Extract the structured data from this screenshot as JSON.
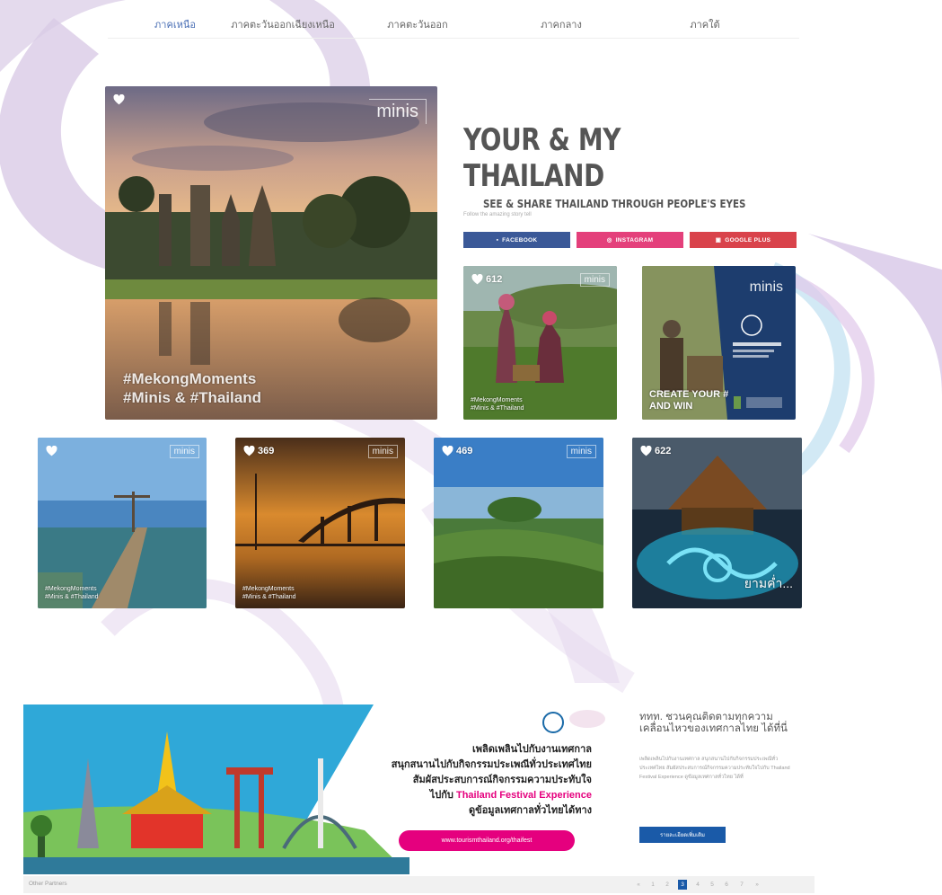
{
  "nav": {
    "items": [
      "ภาคเหนือ",
      "ภาคตะวันออกเฉียงเหนือ",
      "ภาคตะวันออก",
      "ภาคกลาง",
      "ภาคใต้"
    ],
    "active_color": "#4a6fb5"
  },
  "hero": {
    "title_line1": "YOUR & MY",
    "title_line2": "THAILAND",
    "subtitle": "SEE & SHARE THAILAND THROUGH PEOPLE'S EYES",
    "note": "Follow the amazing story tell",
    "main_photo": {
      "brand": "minis",
      "caption_line1": "#MekongMoments",
      "caption_line2": "#Minis & #Thailand"
    }
  },
  "social_buttons": [
    {
      "label": "FACEBOOK",
      "color": "#3b5998",
      "icon": "facebook-icon"
    },
    {
      "label": "INSTAGRAM",
      "color": "#e4407b",
      "icon": "instagram-icon"
    },
    {
      "label": "GOOGLE PLUS",
      "color": "#d9434b",
      "icon": "google-plus-icon"
    }
  ],
  "small_photos": [
    {
      "likes": "612",
      "brand": "minis",
      "caption_line1": "#MekongMoments",
      "caption_line2": "#Minis & #Thailand"
    },
    {
      "brand": "minis",
      "caption_line1": "CREATE YOUR #",
      "caption_line2": "AND WIN"
    }
  ],
  "bottom_photos": [
    {
      "likes": "",
      "brand": "minis",
      "caption_line1": "#MekongMoments",
      "caption_line2": "#Minis & #Thailand"
    },
    {
      "likes": "369",
      "brand": "minis",
      "caption_line1": "#MekongMoments",
      "caption_line2": "#Minis & #Thailand"
    },
    {
      "likes": "469",
      "brand": "minis",
      "caption_line1": "",
      "caption_line2": ""
    },
    {
      "likes": "622",
      "brand": "",
      "caption_line1": "ยามค่ำ...",
      "caption_line2": ""
    }
  ],
  "banner": {
    "line1": "เพลิดเพลินไปกับงานเทศกาล",
    "line2": "สนุกสนานไปกับกิจกรรมประเพณีทั่วประเทศไทย",
    "line3": "สัมผัสประสบการณ์กิจกรรมความประทับใจ",
    "line4_prefix": "ไปกับ",
    "line4_highlight": "Thailand Festival Experience",
    "line5": "ดูข้อมูลเทศกาลทั่วไทยได้ทาง",
    "url": "www.tourismthailand.org/thaifest",
    "highlight_color": "#e5007e"
  },
  "side": {
    "title": "ททท. ชวนคุณติดตามทุกความเคลื่อนไหวของเทศกาลไทย ได้ที่นี่",
    "body": "เพลิดเพลินไปกับงานเทศกาล สนุกสนานไปกับกิจกรรมประเพณีทั่วประเทศไทย สัมผัสประสบการณ์กิจกรรมความประทับใจไปกับ Thailand Festival Experience ดูข้อมูลเทศกาลทั่วไทย ได้ที่",
    "button": "รายละเอียดเพิ่มเติม"
  },
  "footer": {
    "label": "Other Partners",
    "pages": [
      "«",
      "1",
      "2",
      "3",
      "4",
      "5",
      "6",
      "7",
      "»"
    ],
    "active_page": "3"
  }
}
